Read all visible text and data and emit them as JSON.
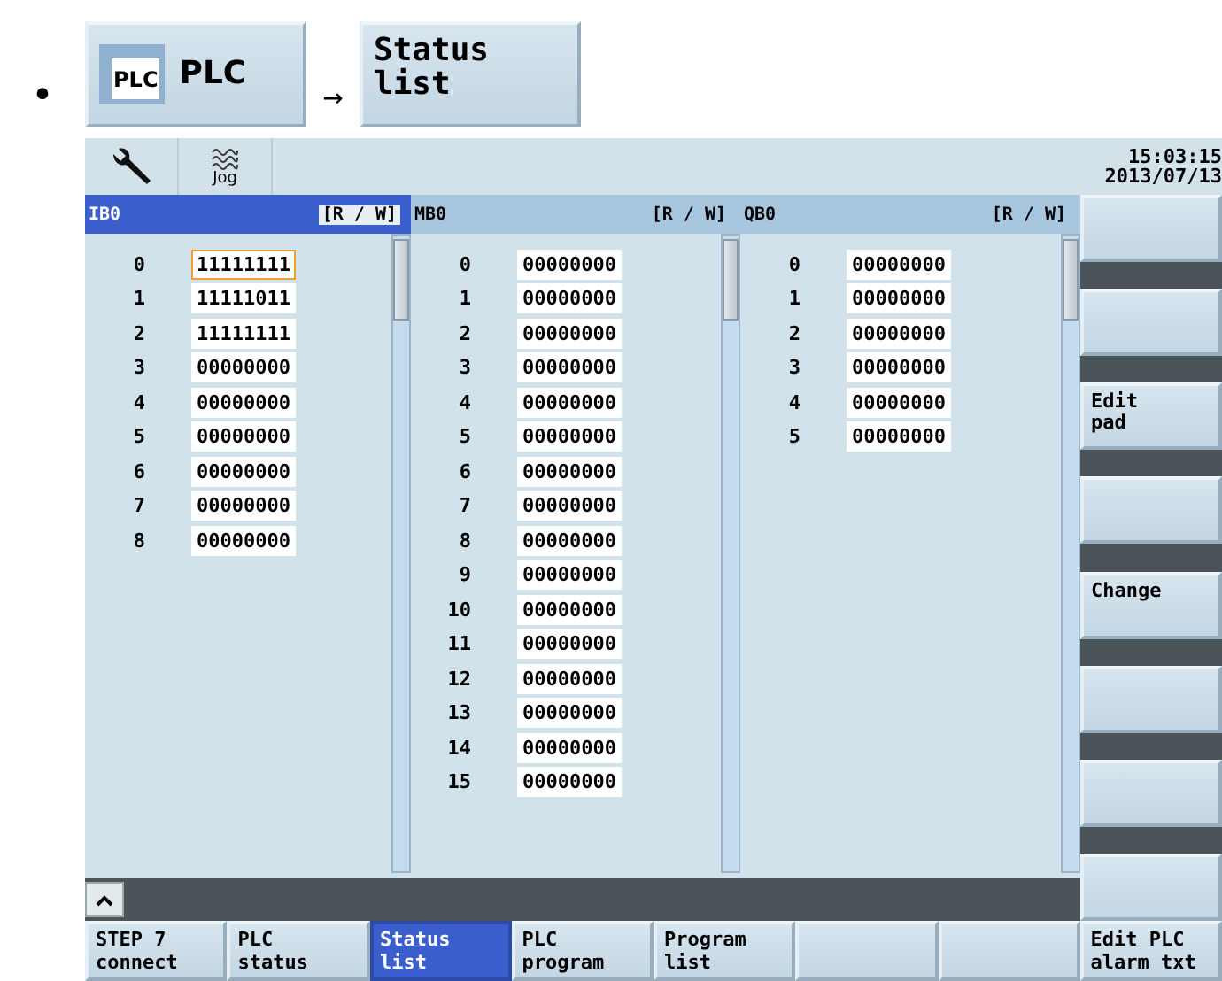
{
  "instruction": {
    "bullet": "•",
    "steps": [
      {
        "kind": "icon",
        "icon_text": "PLC",
        "label": "PLC"
      },
      {
        "kind": "text",
        "label": "Status\nlist"
      }
    ],
    "arrow": "→"
  },
  "toolbar": {
    "jog_label": "Jog",
    "time": "15:03:15",
    "date": "2013/07/13"
  },
  "columns": [
    {
      "title": "IB0",
      "mode": "[R / W]",
      "selected": true,
      "rows": [
        {
          "index": "0",
          "value": "11111111",
          "focused": true
        },
        {
          "index": "1",
          "value": "11111011",
          "focused": false
        },
        {
          "index": "2",
          "value": "11111111",
          "focused": false
        },
        {
          "index": "3",
          "value": "00000000",
          "focused": false
        },
        {
          "index": "4",
          "value": "00000000",
          "focused": false
        },
        {
          "index": "5",
          "value": "00000000",
          "focused": false
        },
        {
          "index": "6",
          "value": "00000000",
          "focused": false
        },
        {
          "index": "7",
          "value": "00000000",
          "focused": false
        },
        {
          "index": "8",
          "value": "00000000",
          "focused": false
        }
      ]
    },
    {
      "title": "MB0",
      "mode": "[R / W]",
      "selected": false,
      "rows": [
        {
          "index": "0",
          "value": "00000000",
          "focused": false
        },
        {
          "index": "1",
          "value": "00000000",
          "focused": false
        },
        {
          "index": "2",
          "value": "00000000",
          "focused": false
        },
        {
          "index": "3",
          "value": "00000000",
          "focused": false
        },
        {
          "index": "4",
          "value": "00000000",
          "focused": false
        },
        {
          "index": "5",
          "value": "00000000",
          "focused": false
        },
        {
          "index": "6",
          "value": "00000000",
          "focused": false
        },
        {
          "index": "7",
          "value": "00000000",
          "focused": false
        },
        {
          "index": "8",
          "value": "00000000",
          "focused": false
        },
        {
          "index": "9",
          "value": "00000000",
          "focused": false
        },
        {
          "index": "10",
          "value": "00000000",
          "focused": false
        },
        {
          "index": "11",
          "value": "00000000",
          "focused": false
        },
        {
          "index": "12",
          "value": "00000000",
          "focused": false
        },
        {
          "index": "13",
          "value": "00000000",
          "focused": false
        },
        {
          "index": "14",
          "value": "00000000",
          "focused": false
        },
        {
          "index": "15",
          "value": "00000000",
          "focused": false
        }
      ]
    },
    {
      "title": "QB0",
      "mode": "[R / W]",
      "selected": false,
      "rows": [
        {
          "index": "0",
          "value": "00000000",
          "focused": false
        },
        {
          "index": "1",
          "value": "00000000",
          "focused": false
        },
        {
          "index": "2",
          "value": "00000000",
          "focused": false
        },
        {
          "index": "3",
          "value": "00000000",
          "focused": false
        },
        {
          "index": "4",
          "value": "00000000",
          "focused": false
        },
        {
          "index": "5",
          "value": "00000000",
          "focused": false
        }
      ]
    }
  ],
  "vertical_softkeys": [
    {
      "kind": "blank"
    },
    {
      "kind": "blank"
    },
    {
      "kind": "text",
      "label": "Edit\npad"
    },
    {
      "kind": "blank"
    },
    {
      "kind": "text",
      "label": "Change"
    },
    {
      "kind": "blank"
    },
    {
      "kind": "blank"
    },
    {
      "kind": "blank"
    }
  ],
  "horizontal_softkeys": [
    {
      "label": "STEP 7\nconnect",
      "selected": false
    },
    {
      "label": "PLC\nstatus",
      "selected": false
    },
    {
      "label": "Status\nlist",
      "selected": true
    },
    {
      "label": "PLC\nprogram",
      "selected": false
    },
    {
      "label": "Program\nlist",
      "selected": false
    },
    {
      "selected": false
    },
    {
      "selected": false
    },
    {
      "label": "Edit PLC\nalarm txt",
      "selected": false
    }
  ]
}
